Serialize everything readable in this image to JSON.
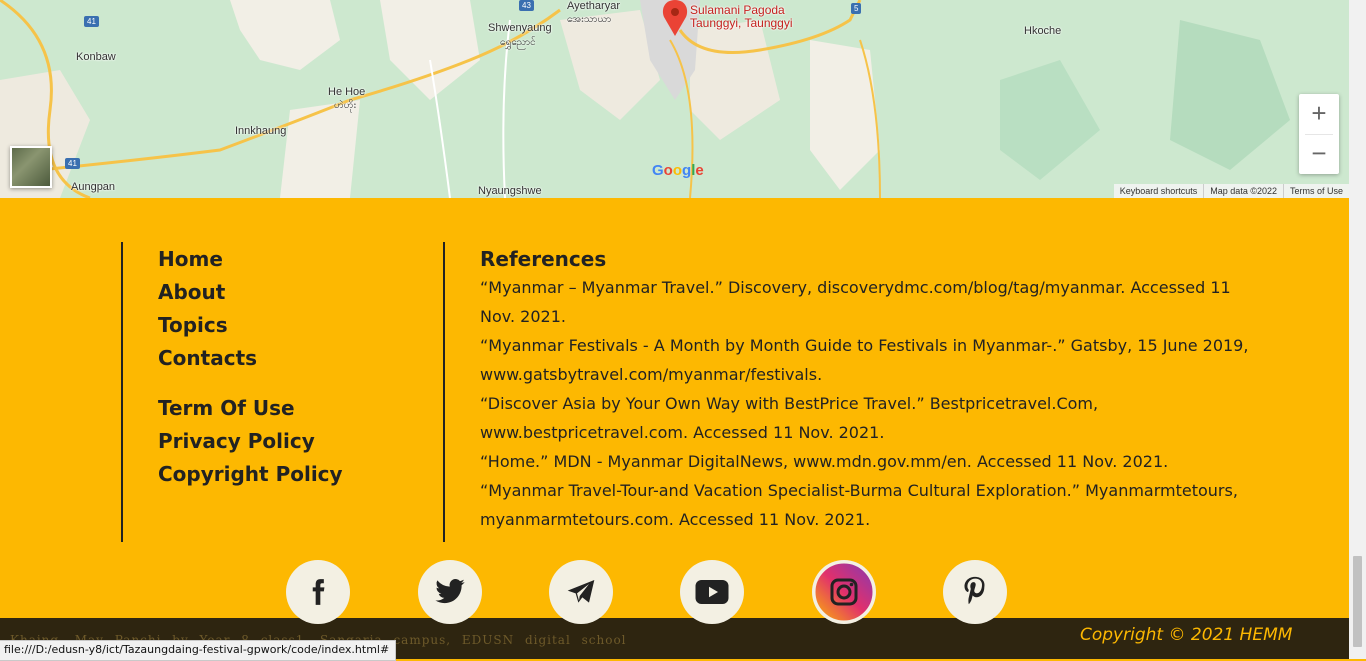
{
  "map": {
    "pin_label_line1": "Sulamani Pagoda",
    "pin_label_line2": "Taunggyi, Taunggyi",
    "places": [
      {
        "id": "ayetharyar",
        "text": "Ayetharyar"
      },
      {
        "id": "ayetharyar-mm",
        "text": "အေးသာယာ"
      },
      {
        "id": "shwenyaung",
        "text": "Shwenyaung"
      },
      {
        "id": "shwenyaung-mm",
        "text": "ရွှေညောင်"
      },
      {
        "id": "konbaw",
        "text": "Konbaw"
      },
      {
        "id": "he-hoe",
        "text": "He Hoe"
      },
      {
        "id": "he-hoe-mm",
        "text": "ဟဲဟိုး"
      },
      {
        "id": "innkhaung",
        "text": "Innkhaung"
      },
      {
        "id": "aungpan",
        "text": "Aungpan"
      },
      {
        "id": "nyaungshwe",
        "text": "Nyaungshwe"
      },
      {
        "id": "hkoche",
        "text": "Hkoche"
      }
    ],
    "road_shields": [
      "41",
      "43",
      "5",
      "41"
    ],
    "google_logo": "Google",
    "attribution": [
      "Keyboard shortcuts",
      "Map data ©2022",
      "Terms of Use"
    ],
    "zoom_in": "+",
    "zoom_out": "−"
  },
  "nav": {
    "home": "Home",
    "about": "About",
    "topics": "Topics",
    "contacts": "Contacts",
    "term_of_use": "Term Of Use",
    "privacy_policy": "Privacy Policy",
    "copyright_policy": "Copyright Policy"
  },
  "references": {
    "title": "References",
    "items": [
      "“Myanmar – Myanmar Travel.” Discovery, discoverydmc.com/blog/tag/myanmar. Accessed 11 Nov. 2021.",
      "“Myanmar Festivals - A Month by Month Guide to Festivals in Myanmar-.” Gatsby, 15 June 2019, www.gatsbytravel.com/myanmar/festivals.",
      "“Discover Asia by Your Own Way with BestPrice Travel.” Bestpricetravel.Com, www.bestpricetravel.com. Accessed 11 Nov. 2021.",
      "“Home.” MDN - Myanmar DigitalNews, www.mdn.gov.mm/en. Accessed 11 Nov. 2021.",
      "“Myanmar Travel-Tour-and Vacation Specialist-Burma Cultural Exploration.” Myanmarmtetours, myanmarmtetours.com. Accessed 11 Nov. 2021."
    ]
  },
  "social": {
    "icons": [
      "facebook-icon",
      "twitter-icon",
      "telegram-icon",
      "youtube-icon",
      "instagram-icon",
      "pinterest-icon"
    ]
  },
  "footer": {
    "credit": "Khaing, May Panchi by Year 8 class1, Sangaria campus, EDUSN digital school",
    "copyright": "Copyright © 2021 HEMM"
  },
  "status_bar": {
    "url": "file:///D:/edusn-y8/ict/Tazaungdaing-festival-gpwork/code/index.html#"
  },
  "colors": {
    "footer_bg": "#fdb801",
    "text": "#222222",
    "bottom_bar": "#2e2510",
    "pin": "#ea4335"
  }
}
